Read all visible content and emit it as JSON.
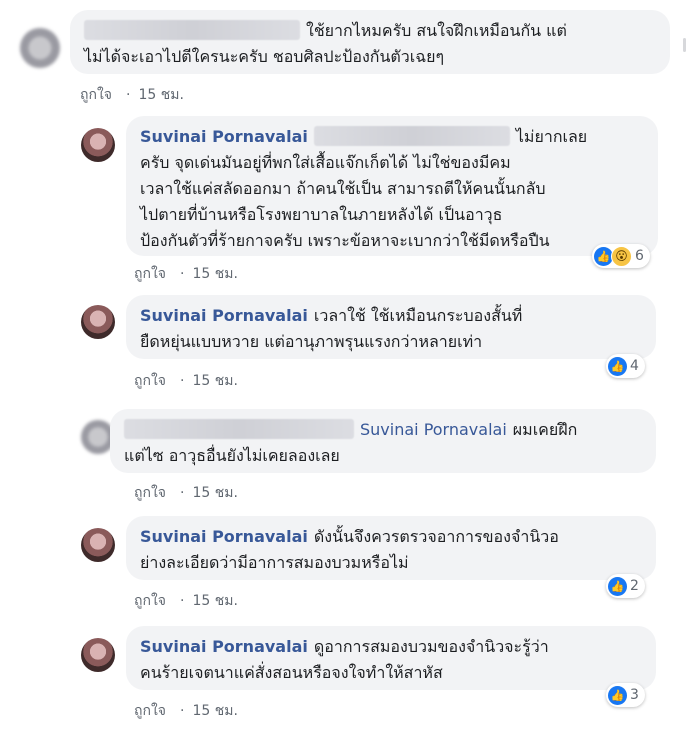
{
  "comments": [
    {
      "author": "",
      "lines": [
        "ใช้ยากไหมครับ สนใจฝึกเหมือนกัน แต่",
        "ไม่ได้จะเอาไปตีใครนะครับ ชอบศิลปะป้องกันตัวเฉยๆ"
      ],
      "like_label": "ถูกใจ",
      "time": "15 ชม.",
      "reaction_count": ""
    },
    {
      "author": "Suvinai Pornavalai",
      "lines": [
        "ไม่ยากเลย",
        "ครับ จุดเด่นมันอยู่ที่พกใส่เสื้อแจ๊กเก็ตได้ ไม่ใช่ของมีคม",
        "เวลาใช้แค่สลัดออกมา ถ้าคนใช้เป็น สามารถตีให้คนนั้นกลับ",
        "ไปตายที่บ้านหรือโรงพยาบาลในภายหลังได้ เป็นอาวุธ",
        "ป้องกันตัวที่ร้ายกาจครับ เพราะข้อหาจะเบากว่าใช้มีดหรือปืน"
      ],
      "like_label": "ถูกใจ",
      "time": "15 ชม.",
      "reaction_count": "6"
    },
    {
      "author": "Suvinai Pornavalai",
      "lines": [
        "เวลาใช้ ใช้เหมือนกระบองสั้นที่",
        "ยืดหยุ่นแบบหวาย แต่อานุภาพรุนแรงกว่าหลายเท่า"
      ],
      "like_label": "ถูกใจ",
      "time": "15 ชม.",
      "reaction_count": "4"
    },
    {
      "author": "",
      "tag": "Suvinai Pornavalai",
      "lines": [
        "ผมเคยฝึก",
        "แต่ไซ อาวุธอื่นยังไม่เคยลองเลย"
      ],
      "like_label": "ถูกใจ",
      "time": "15 ชม.",
      "reaction_count": ""
    },
    {
      "author": "Suvinai Pornavalai",
      "lines": [
        "ดังนั้นจึงควรตรวจอาการของจำนิวอ",
        "ย่างละเอียดว่ามีอาการสมองบวมหรือไม่"
      ],
      "like_label": "ถูกใจ",
      "time": "15 ชม.",
      "reaction_count": "2"
    },
    {
      "author": "Suvinai Pornavalai",
      "lines": [
        "ดูอาการสมองบวมของจำนิวจะรู้ว่า",
        "คนร้ายเจตนาแค่สั่งสอนหรือจงใจทำให้สาหัส"
      ],
      "like_label": "ถูกใจ",
      "time": "15 ชม.",
      "reaction_count": "3"
    }
  ],
  "icons": {
    "like": "thumbs-up-icon",
    "wow": "wow-icon"
  },
  "colors": {
    "name": "#385898",
    "bubble": "#f2f3f5",
    "meta": "#606770",
    "like_blue": "#1877f2"
  }
}
